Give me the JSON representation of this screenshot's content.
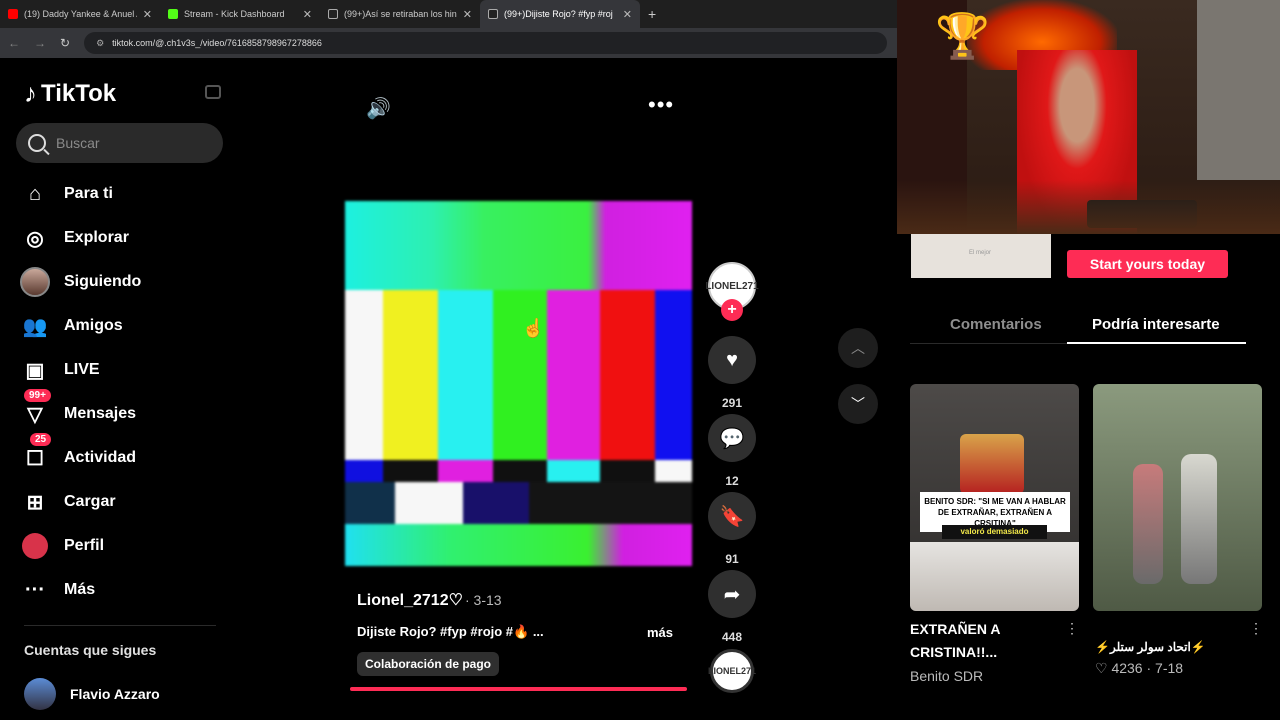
{
  "browser": {
    "tabs": [
      {
        "title": "(19) Daddy Yankee & Anuel AA",
        "color": "#ff0000"
      },
      {
        "title": "Stream - Kick Dashboard",
        "color": "#53fc18"
      },
      {
        "title": "(99+)Así se retiraban los hincha",
        "color": "#ffffff"
      },
      {
        "title": "(99+)Dijiste Rojo? #fyp #roj",
        "color": "#ffffff"
      }
    ],
    "new_tab": "+",
    "url": "tiktok.com/@.ch1v3s_/video/7616858798967278866"
  },
  "sidebar": {
    "logo_text": "TikTok",
    "search_placeholder": "Buscar",
    "items": [
      {
        "label": "Para ti",
        "icon": "home-icon"
      },
      {
        "label": "Explorar",
        "icon": "compass-icon"
      },
      {
        "label": "Siguiendo",
        "icon": "avatar-icon"
      },
      {
        "label": "Amigos",
        "icon": "friends-icon"
      },
      {
        "label": "LIVE",
        "icon": "live-icon"
      },
      {
        "label": "Mensajes",
        "icon": "messages-icon",
        "badge": "99+"
      },
      {
        "label": "Actividad",
        "icon": "activity-icon",
        "badge": "25"
      },
      {
        "label": "Cargar",
        "icon": "upload-icon"
      },
      {
        "label": "Perfil",
        "icon": "profile-icon"
      },
      {
        "label": "Más",
        "icon": "more-icon"
      }
    ],
    "following_title": "Cuentas que sigues",
    "following": [
      {
        "name": "Flavio Azzaro"
      }
    ]
  },
  "video": {
    "author": "Lionel_2712♡",
    "date": "· 3-13",
    "caption": "Dijiste Rojo? #fyp #rojo #🔥 ...",
    "more": "más",
    "paid_label": "Colaboración de pago",
    "likes": "291",
    "comments": "12",
    "saves": "91",
    "shares": "448",
    "creator_badge": "LIONEL271"
  },
  "right": {
    "ad_label": "El mejor",
    "start_button": "Start yours today",
    "tabs": [
      "Comentarios",
      "Podría interesarte"
    ],
    "cards": [
      {
        "title": "EXTRAÑEN A CRISTINA!!...",
        "meta": "Benito SDR",
        "overlay_text": "BENITO SDR: \"SI ME VAN A HABLAR DE EXTRAÑAR, EXTRAÑEN A CRSITINA\"",
        "overlay_sub": "valoró demasiado"
      },
      {
        "title": "⚡اتحاد سولر ستلر⚡",
        "meta": "♡ 4236 · 7-18"
      }
    ]
  }
}
